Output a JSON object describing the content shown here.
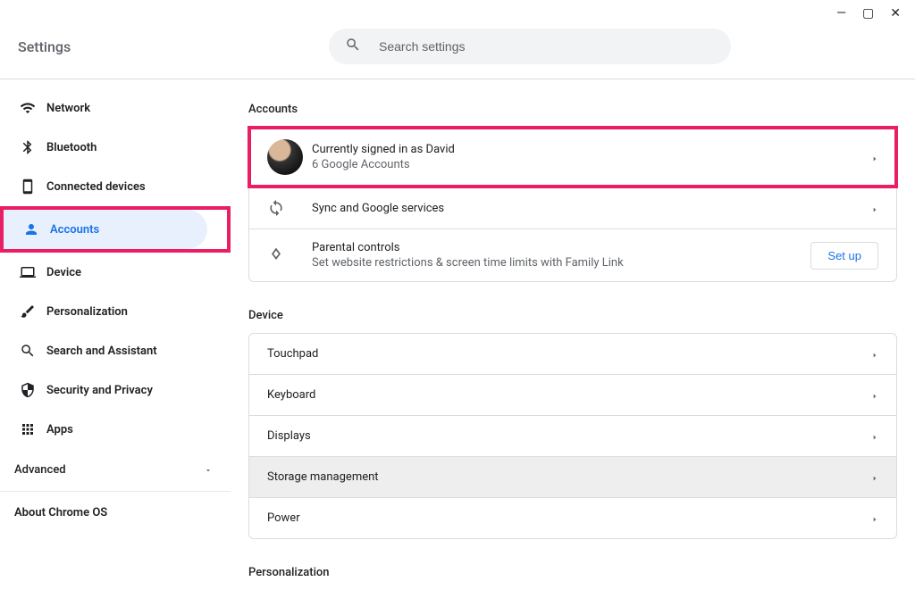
{
  "window_controls": {
    "minimize": "—",
    "maximize": "▢",
    "close": "✕"
  },
  "header": {
    "title": "Settings"
  },
  "search": {
    "placeholder": "Search settings"
  },
  "sidebar": {
    "items": [
      {
        "label": "Network",
        "icon": "wifi",
        "active": false
      },
      {
        "label": "Bluetooth",
        "icon": "bluetooth",
        "active": false
      },
      {
        "label": "Connected devices",
        "icon": "devices",
        "active": false
      },
      {
        "label": "Accounts",
        "icon": "person",
        "active": true
      },
      {
        "label": "Device",
        "icon": "laptop",
        "active": false
      },
      {
        "label": "Personalization",
        "icon": "brush",
        "active": false
      },
      {
        "label": "Search and Assistant",
        "icon": "search",
        "active": false
      },
      {
        "label": "Security and Privacy",
        "icon": "shield",
        "active": false
      },
      {
        "label": "Apps",
        "icon": "apps",
        "active": false
      }
    ],
    "advanced_label": "Advanced",
    "about_label": "About Chrome OS"
  },
  "sections": {
    "accounts": {
      "title": "Accounts",
      "rows": [
        {
          "title": "Currently signed in as David",
          "sub": "6 Google Accounts",
          "icon": "avatar"
        },
        {
          "title": "Sync and Google services",
          "sub": "",
          "icon": "sync"
        },
        {
          "title": "Parental controls",
          "sub": "Set website restrictions & screen time limits with Family Link",
          "icon": "kite",
          "action": "Set up"
        }
      ]
    },
    "device": {
      "title": "Device",
      "rows": [
        {
          "title": "Touchpad"
        },
        {
          "title": "Keyboard"
        },
        {
          "title": "Displays"
        },
        {
          "title": "Storage management",
          "hover": true
        },
        {
          "title": "Power"
        }
      ]
    },
    "personalization": {
      "title": "Personalization"
    }
  }
}
